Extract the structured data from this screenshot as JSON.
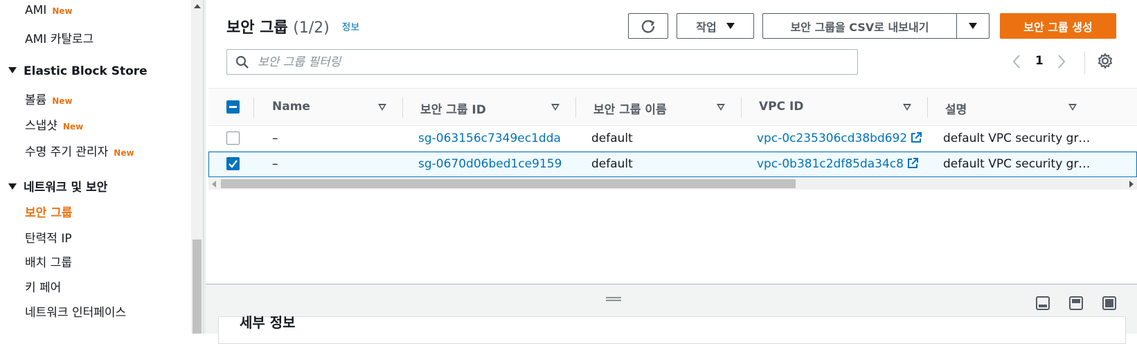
{
  "sidebar": {
    "items_top": [
      {
        "label": "AMI",
        "badge": "New"
      },
      {
        "label": "AMI 카탈로그",
        "badge": ""
      }
    ],
    "sections": [
      {
        "title": "Elastic Block Store",
        "items": [
          {
            "label": "볼륨",
            "badge": "New"
          },
          {
            "label": "스냅샷",
            "badge": "New"
          },
          {
            "label": "수명 주기 관리자",
            "badge": "New"
          }
        ]
      },
      {
        "title": "네트워크 및 보안",
        "items": [
          {
            "label": "보안 그룹",
            "active": true
          },
          {
            "label": "탄력적 IP"
          },
          {
            "label": "배치 그룹"
          },
          {
            "label": "키 페어"
          },
          {
            "label": "네트워크 인터페이스"
          }
        ]
      }
    ]
  },
  "header": {
    "title": "보안 그룹",
    "count": "(1/2)",
    "info_link": "정보",
    "actions_label": "작업",
    "export_label": "보안 그룹을 CSV로 내보내기",
    "create_label": "보안 그룹 생성"
  },
  "search": {
    "placeholder": "보안 그룹 필터링"
  },
  "pagination": {
    "current_page": "1"
  },
  "table": {
    "columns": [
      "Name",
      "보안 그룹 ID",
      "보안 그룹 이름",
      "VPC ID",
      "설명"
    ],
    "rows": [
      {
        "selected": false,
        "name": "–",
        "id": "sg-063156c7349ec1dda",
        "group_name": "default",
        "vpc": "vpc-0c235306cd38bd692",
        "desc": "default VPC security gr…"
      },
      {
        "selected": true,
        "name": "–",
        "id": "sg-0670d06bed1ce9159",
        "group_name": "default",
        "vpc": "vpc-0b381c2df85da34c8",
        "desc": "default VPC security gr…"
      }
    ]
  },
  "split_panel": {
    "heading": "세부 정보"
  },
  "colors": {
    "accent": "#ec7211",
    "link": "#0073bb"
  }
}
